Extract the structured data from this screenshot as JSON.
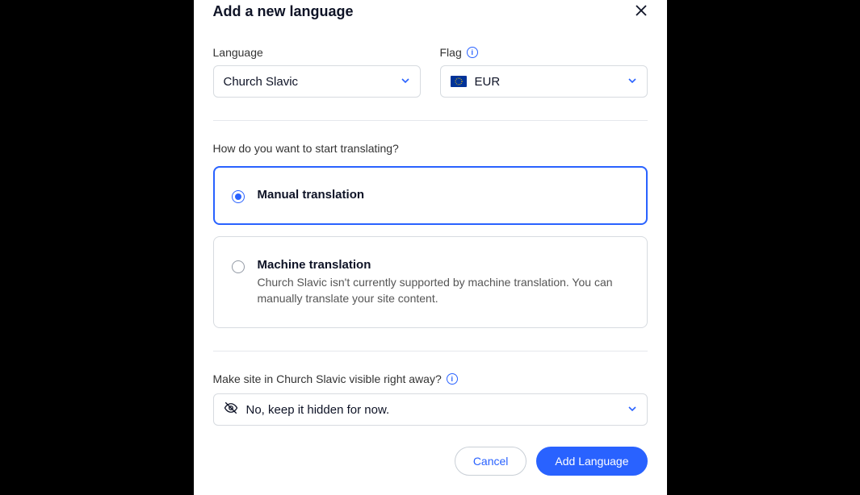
{
  "modal": {
    "title": "Add a new language"
  },
  "fields": {
    "language": {
      "label": "Language",
      "value": "Church Slavic"
    },
    "flag": {
      "label": "Flag",
      "value": "EUR"
    }
  },
  "translation": {
    "prompt": "How do you want to start translating?",
    "options": {
      "manual": {
        "title": "Manual translation",
        "selected": true
      },
      "machine": {
        "title": "Machine translation",
        "description": "Church Slavic isn't currently supported by machine translation. You can manually translate your site content.",
        "selected": false
      }
    }
  },
  "visibility": {
    "label": "Make site in Church Slavic visible right away?",
    "value": "No, keep it hidden for now."
  },
  "buttons": {
    "cancel": "Cancel",
    "add": "Add Language"
  }
}
